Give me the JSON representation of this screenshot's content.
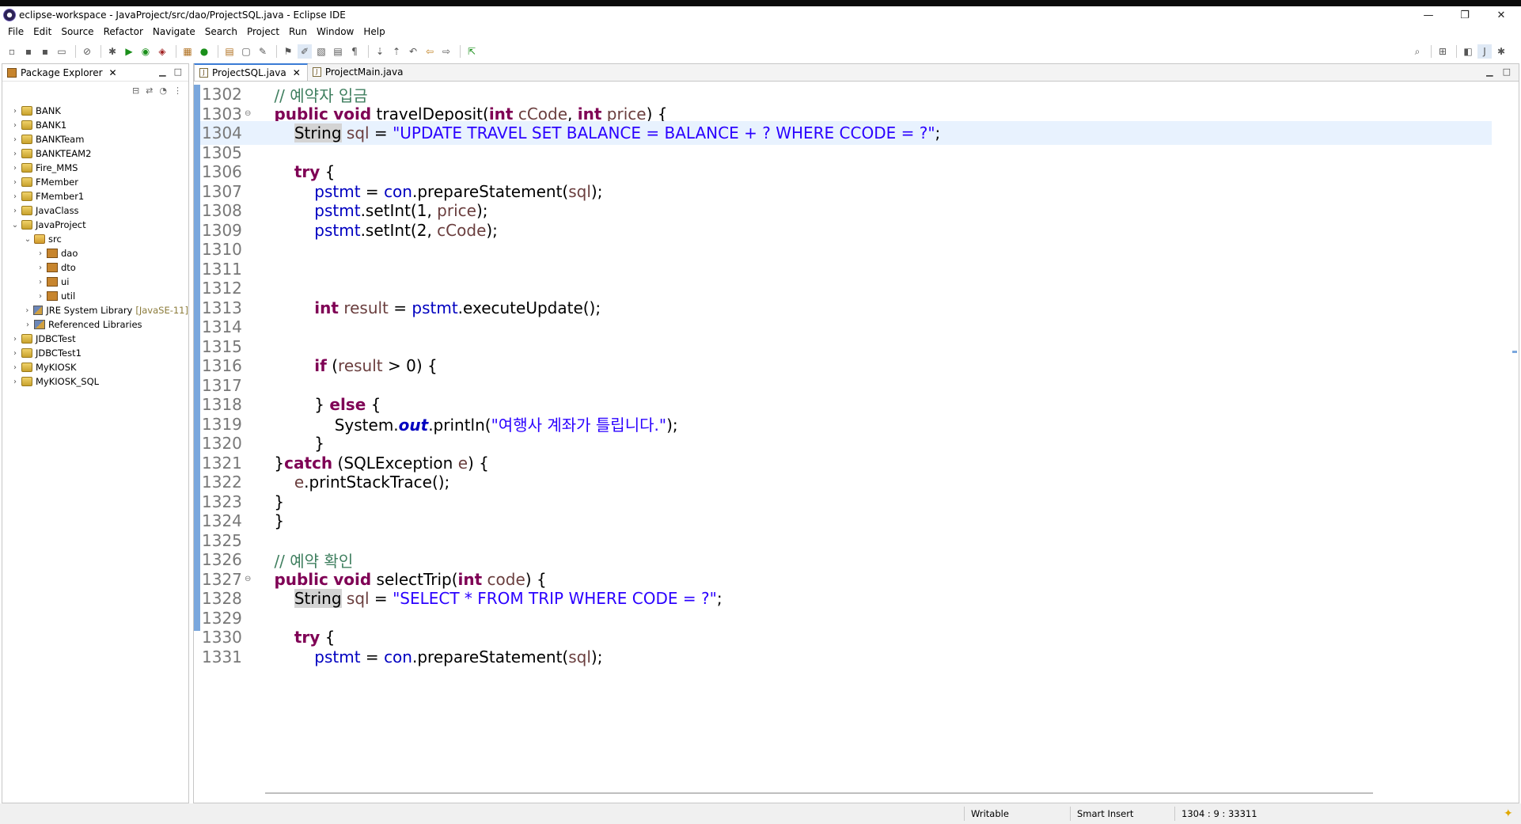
{
  "window": {
    "title": "eclipse-workspace - JavaProject/src/dao/ProjectSQL.java - Eclipse IDE",
    "minimize": "—",
    "restore": "❐",
    "close": "✕"
  },
  "menu": [
    "File",
    "Edit",
    "Source",
    "Refactor",
    "Navigate",
    "Search",
    "Project",
    "Run",
    "Window",
    "Help"
  ],
  "package_explorer": {
    "tab_label": "Package Explorer",
    "close": "✕",
    "tree": [
      {
        "label": "BANK",
        "level": 0,
        "expanded": false,
        "icon": "project"
      },
      {
        "label": "BANK1",
        "level": 0,
        "expanded": false,
        "icon": "project"
      },
      {
        "label": "BANKTeam",
        "level": 0,
        "expanded": false,
        "icon": "project"
      },
      {
        "label": "BANKTEAM2",
        "level": 0,
        "expanded": false,
        "icon": "project"
      },
      {
        "label": "Fire_MMS",
        "level": 0,
        "expanded": false,
        "icon": "project"
      },
      {
        "label": "FMember",
        "level": 0,
        "expanded": false,
        "icon": "project"
      },
      {
        "label": "FMember1",
        "level": 0,
        "expanded": false,
        "icon": "project"
      },
      {
        "label": "JavaClass",
        "level": 0,
        "expanded": false,
        "icon": "project"
      },
      {
        "label": "JavaProject",
        "level": 0,
        "expanded": true,
        "icon": "project"
      },
      {
        "label": "src",
        "level": 1,
        "expanded": true,
        "icon": "src"
      },
      {
        "label": "dao",
        "level": 2,
        "expanded": false,
        "icon": "package"
      },
      {
        "label": "dto",
        "level": 2,
        "expanded": false,
        "icon": "package"
      },
      {
        "label": "ui",
        "level": 2,
        "expanded": false,
        "icon": "package"
      },
      {
        "label": "util",
        "level": 2,
        "expanded": false,
        "icon": "package"
      },
      {
        "label": "JRE System Library",
        "suffix": "[JavaSE-11]",
        "level": 1,
        "expanded": false,
        "icon": "library"
      },
      {
        "label": "Referenced Libraries",
        "level": 1,
        "expanded": false,
        "icon": "library"
      },
      {
        "label": "JDBCTest",
        "level": 0,
        "expanded": false,
        "icon": "project"
      },
      {
        "label": "JDBCTest1",
        "level": 0,
        "expanded": false,
        "icon": "project"
      },
      {
        "label": "MyKIOSK",
        "level": 0,
        "expanded": false,
        "icon": "project"
      },
      {
        "label": "MyKIOSK_SQL",
        "level": 0,
        "expanded": false,
        "icon": "project"
      }
    ]
  },
  "editor": {
    "tabs": [
      {
        "label": "ProjectSQL.java",
        "active": true,
        "close": "✕"
      },
      {
        "label": "ProjectMain.java",
        "active": false
      }
    ],
    "lines": [
      {
        "n": "1302",
        "tokens": [
          [
            "    ",
            ""
          ],
          [
            "// 예약자 입금",
            "cmt"
          ]
        ]
      },
      {
        "n": "1303",
        "fold": "⊖",
        "tokens": [
          [
            "    ",
            ""
          ],
          [
            "public",
            "kw"
          ],
          [
            " ",
            ""
          ],
          [
            "void",
            "kw"
          ],
          [
            " travelDeposit(",
            ""
          ],
          [
            "int",
            "kw"
          ],
          [
            " ",
            ""
          ],
          [
            "cCode",
            "var"
          ],
          [
            ", ",
            ""
          ],
          [
            "int",
            "kw"
          ],
          [
            " ",
            ""
          ],
          [
            "price",
            "var"
          ],
          [
            ") {",
            ""
          ]
        ]
      },
      {
        "n": "1304",
        "highlight": true,
        "tokens": [
          [
            "        ",
            ""
          ],
          [
            "String",
            "occ"
          ],
          [
            " ",
            ""
          ],
          [
            "sql",
            "var"
          ],
          [
            " = ",
            ""
          ],
          [
            "\"UPDATE TRAVEL SET BALANCE = BALANCE + ? WHERE CCODE = ?\"",
            "str"
          ],
          [
            ";",
            ""
          ]
        ]
      },
      {
        "n": "1305",
        "tokens": []
      },
      {
        "n": "1306",
        "tokens": [
          [
            "        ",
            ""
          ],
          [
            "try",
            "kw"
          ],
          [
            " {",
            ""
          ]
        ]
      },
      {
        "n": "1307",
        "tokens": [
          [
            "            ",
            ""
          ],
          [
            "pstmt",
            "fld"
          ],
          [
            " = ",
            ""
          ],
          [
            "con",
            "fld"
          ],
          [
            ".prepareStatement(",
            ""
          ],
          [
            "sql",
            "var"
          ],
          [
            ");",
            ""
          ]
        ]
      },
      {
        "n": "1308",
        "tokens": [
          [
            "            ",
            ""
          ],
          [
            "pstmt",
            "fld"
          ],
          [
            ".setInt(1, ",
            ""
          ],
          [
            "price",
            "var"
          ],
          [
            ");",
            ""
          ]
        ]
      },
      {
        "n": "1309",
        "tokens": [
          [
            "            ",
            ""
          ],
          [
            "pstmt",
            "fld"
          ],
          [
            ".setInt(2, ",
            ""
          ],
          [
            "cCode",
            "var"
          ],
          [
            ");",
            ""
          ]
        ]
      },
      {
        "n": "1310",
        "tokens": []
      },
      {
        "n": "1311",
        "tokens": []
      },
      {
        "n": "1312",
        "tokens": []
      },
      {
        "n": "1313",
        "tokens": [
          [
            "            ",
            ""
          ],
          [
            "int",
            "kw"
          ],
          [
            " ",
            ""
          ],
          [
            "result",
            "var"
          ],
          [
            " = ",
            ""
          ],
          [
            "pstmt",
            "fld"
          ],
          [
            ".executeUpdate();",
            ""
          ]
        ]
      },
      {
        "n": "1314",
        "tokens": []
      },
      {
        "n": "1315",
        "tokens": []
      },
      {
        "n": "1316",
        "tokens": [
          [
            "            ",
            ""
          ],
          [
            "if",
            "kw"
          ],
          [
            " (",
            ""
          ],
          [
            "result",
            "var"
          ],
          [
            " > 0) {",
            ""
          ]
        ]
      },
      {
        "n": "1317",
        "tokens": []
      },
      {
        "n": "1318",
        "tokens": [
          [
            "            } ",
            ""
          ],
          [
            "else",
            "kw"
          ],
          [
            " {",
            ""
          ]
        ]
      },
      {
        "n": "1319",
        "tokens": [
          [
            "                System.",
            ""
          ],
          [
            "out",
            "stat"
          ],
          [
            ".println(",
            ""
          ],
          [
            "\"여행사 계좌가 틀립니다.\"",
            "str"
          ],
          [
            ");",
            ""
          ]
        ]
      },
      {
        "n": "1320",
        "tokens": [
          [
            "            }",
            ""
          ]
        ]
      },
      {
        "n": "1321",
        "tokens": [
          [
            "    }",
            ""
          ],
          [
            "catch",
            "kw"
          ],
          [
            " (SQLException ",
            ""
          ],
          [
            "e",
            "var"
          ],
          [
            ") {",
            ""
          ]
        ]
      },
      {
        "n": "1322",
        "tokens": [
          [
            "        ",
            ""
          ],
          [
            "e",
            "var"
          ],
          [
            ".printStackTrace();",
            ""
          ]
        ]
      },
      {
        "n": "1323",
        "tokens": [
          [
            "    }",
            ""
          ]
        ]
      },
      {
        "n": "1324",
        "tokens": [
          [
            "    }",
            ""
          ]
        ]
      },
      {
        "n": "1325",
        "tokens": []
      },
      {
        "n": "1326",
        "tokens": [
          [
            "    ",
            ""
          ],
          [
            "// 예약 확인",
            "cmt"
          ]
        ]
      },
      {
        "n": "1327",
        "fold": "⊖",
        "tokens": [
          [
            "    ",
            ""
          ],
          [
            "public",
            "kw"
          ],
          [
            " ",
            ""
          ],
          [
            "void",
            "kw"
          ],
          [
            " selectTrip(",
            ""
          ],
          [
            "int",
            "kw"
          ],
          [
            " ",
            ""
          ],
          [
            "code",
            "var"
          ],
          [
            ") {",
            ""
          ]
        ]
      },
      {
        "n": "1328",
        "tokens": [
          [
            "        ",
            ""
          ],
          [
            "String",
            "occ"
          ],
          [
            " ",
            ""
          ],
          [
            "sql",
            "var"
          ],
          [
            " = ",
            ""
          ],
          [
            "\"SELECT * FROM TRIP WHERE CODE = ?\"",
            "str"
          ],
          [
            ";",
            ""
          ]
        ]
      },
      {
        "n": "1329",
        "tokens": []
      },
      {
        "n": "1330",
        "tokens": [
          [
            "        ",
            ""
          ],
          [
            "try",
            "kw"
          ],
          [
            " {",
            ""
          ]
        ]
      },
      {
        "n": "1331",
        "tokens": [
          [
            "            ",
            ""
          ],
          [
            "pstmt",
            "fld"
          ],
          [
            " = ",
            ""
          ],
          [
            "con",
            "fld"
          ],
          [
            ".prepareStatement(",
            ""
          ],
          [
            "sql",
            "var"
          ],
          [
            ");",
            ""
          ]
        ]
      }
    ]
  },
  "status": {
    "writable": "Writable",
    "insert_mode": "Smart Insert",
    "position": "1304 : 9 : 33311"
  },
  "colors": {
    "keyword": "#7f0055",
    "string": "#2a00ff",
    "comment": "#3f7f5f",
    "field": "#0000c0",
    "current_line": "#e8f2fe",
    "change_bar": "#7aa7dd"
  }
}
